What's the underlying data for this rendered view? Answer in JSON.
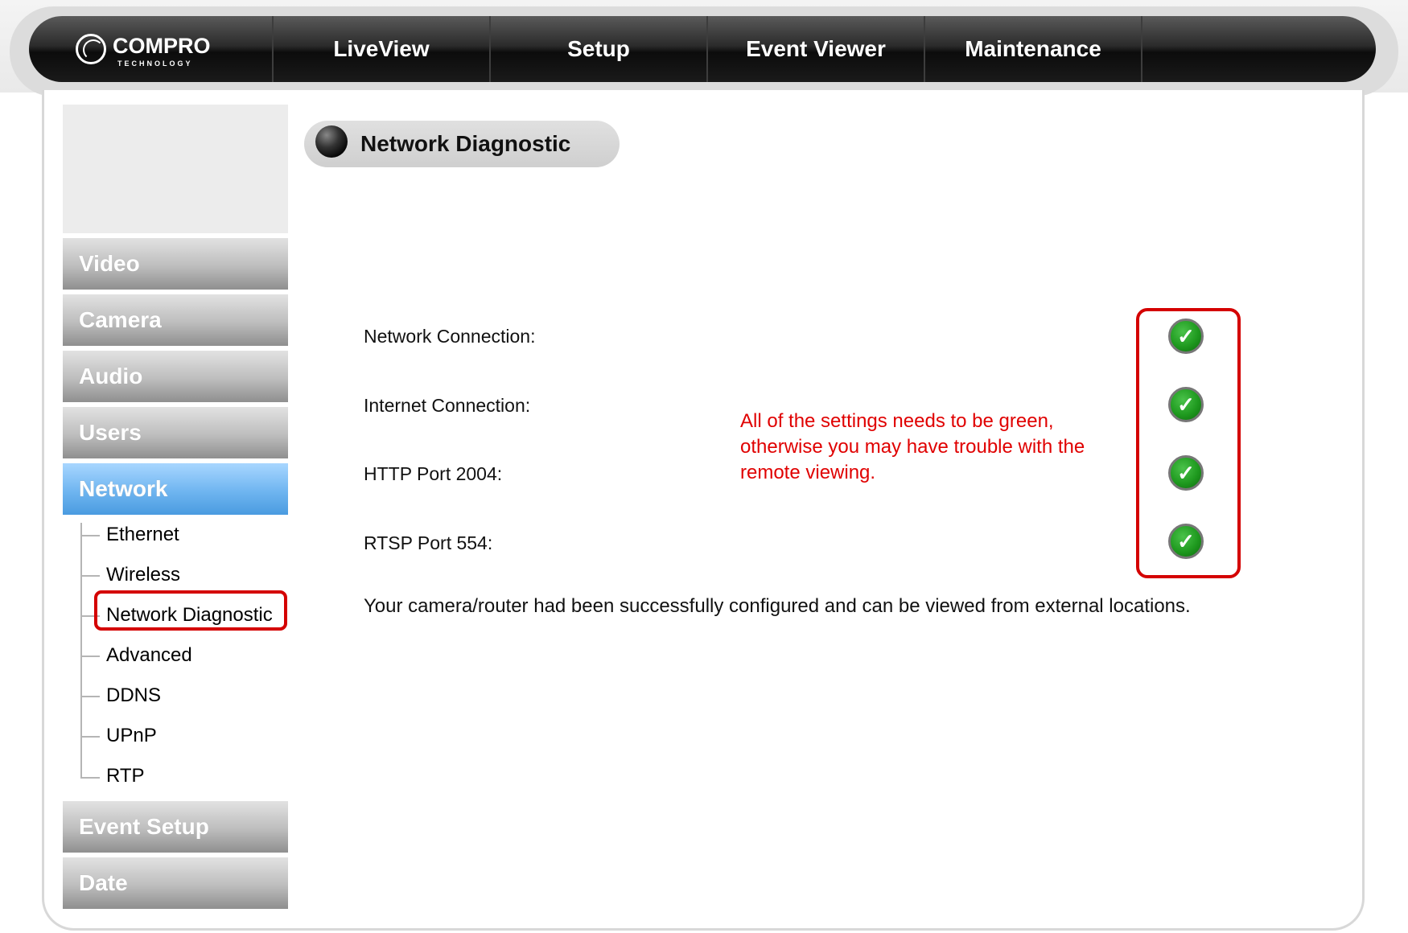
{
  "header": {
    "logo_text": "COMPRO",
    "logo_sub": "TECHNOLOGY",
    "nav": [
      {
        "label": "LiveView"
      },
      {
        "label": "Setup"
      },
      {
        "label": "Event Viewer"
      },
      {
        "label": "Maintenance"
      }
    ]
  },
  "sidebar": {
    "items": [
      {
        "label": "Video"
      },
      {
        "label": "Camera"
      },
      {
        "label": "Audio"
      },
      {
        "label": "Users"
      },
      {
        "label": "Network",
        "active": true
      },
      {
        "label": "Event Setup"
      },
      {
        "label": "Date"
      }
    ],
    "network_subitems": [
      {
        "label": "Ethernet"
      },
      {
        "label": "Wireless"
      },
      {
        "label": "Network Diagnostic",
        "selected": true
      },
      {
        "label": "Advanced"
      },
      {
        "label": "DDNS"
      },
      {
        "label": "UPnP"
      },
      {
        "label": "RTP"
      }
    ]
  },
  "main": {
    "title": "Network Diagnostic",
    "checks": [
      {
        "label": "Network Connection:",
        "status": "ok"
      },
      {
        "label": "Internet Connection:",
        "status": "ok"
      },
      {
        "label": "HTTP Port 2004:",
        "status": "ok"
      },
      {
        "label": "RTSP Port 554:",
        "status": "ok"
      }
    ],
    "status_message": "Your camera/router had been successfully configured and can be viewed from external locations.",
    "annotation": "All of the settings needs to be green, otherwise you may have trouble with the remote viewing."
  },
  "colors": {
    "annotation_red": "#e00000",
    "active_blue": "#6fb5f0",
    "check_green": "#1f9a1f"
  }
}
